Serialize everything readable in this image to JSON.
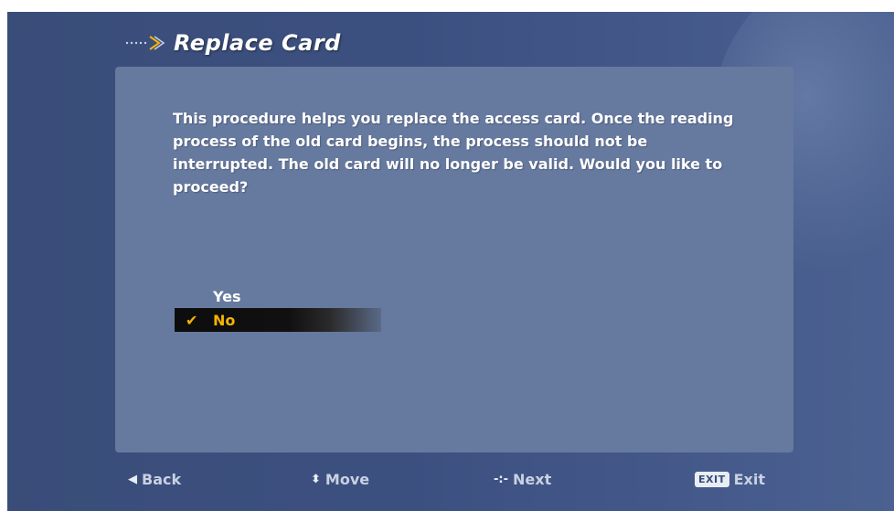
{
  "screen": {
    "title": "Replace Card",
    "message": "This procedure helps you replace the access card. Once the reading process of the old card begins, the process should not be interrupted. The old card will no longer be valid. Would you like to proceed?"
  },
  "options": {
    "yes_label": "Yes",
    "no_label": "No",
    "selected": "No",
    "check_glyph": "✔"
  },
  "footer": {
    "back_icon": "◀",
    "back_label": "Back",
    "move_icon": "⬍",
    "move_label": "Move",
    "next_icon": "-:-",
    "next_label": "Next",
    "exit_badge": "EXIT",
    "exit_label": "Exit"
  },
  "colors": {
    "background": "#3c5080",
    "panel": "#66799f",
    "highlight": "#f5b400",
    "text": "#ffffff"
  }
}
